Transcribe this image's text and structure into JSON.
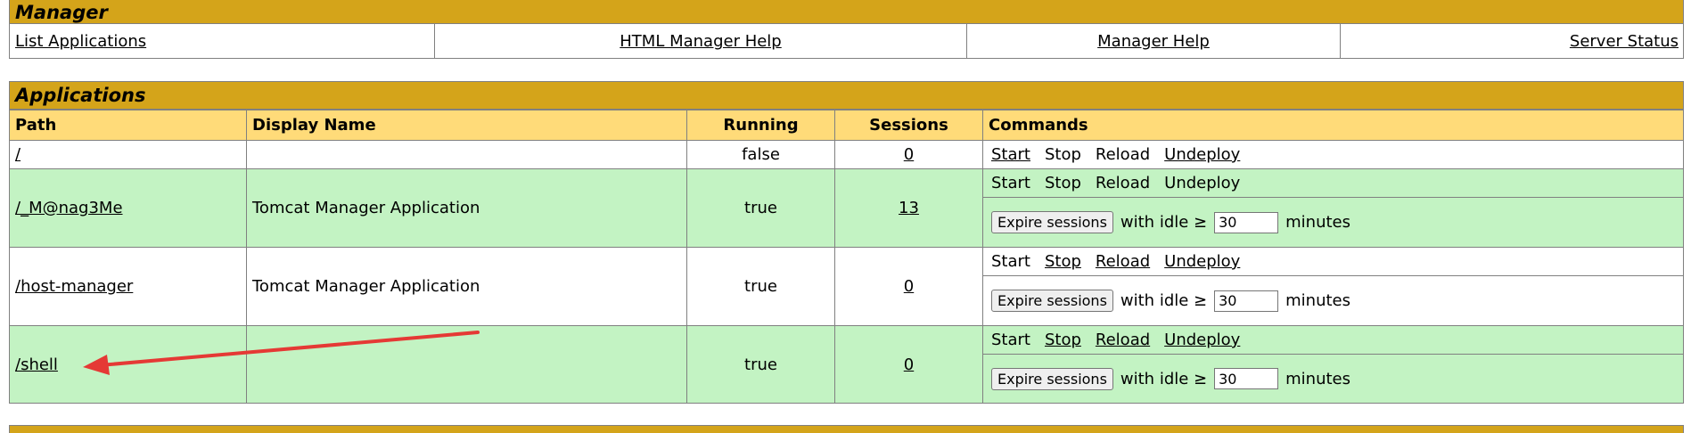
{
  "manager": {
    "title": "Manager",
    "links": [
      {
        "label": "List Applications"
      },
      {
        "label": "HTML Manager Help"
      },
      {
        "label": "Manager Help"
      },
      {
        "label": "Server Status"
      }
    ]
  },
  "applications": {
    "title": "Applications",
    "columns": [
      "Path",
      "Display Name",
      "Running",
      "Sessions",
      "Commands"
    ],
    "rows": [
      {
        "path": "/",
        "display_name": "",
        "running": "false",
        "sessions": "0"
      },
      {
        "path": "/_M@nag3Me",
        "display_name": "Tomcat Manager Application",
        "running": "true",
        "sessions": "13"
      },
      {
        "path": "/host-manager",
        "display_name": "Tomcat Manager Application",
        "running": "true",
        "sessions": "0"
      },
      {
        "path": "/shell",
        "display_name": "",
        "running": "true",
        "sessions": "0"
      }
    ],
    "commands": {
      "start": "Start",
      "stop": "Stop",
      "reload": "Reload",
      "undeploy": "Undeploy",
      "expire_button": "Expire sessions",
      "with_idle": "with idle ≥",
      "idle_value": "30",
      "minutes": "minutes"
    }
  },
  "colors": {
    "title_bar": "#D4A41A",
    "header_row": "#FFDB79",
    "highlight_row": "#C3F3C3",
    "arrow": "#E53935"
  }
}
